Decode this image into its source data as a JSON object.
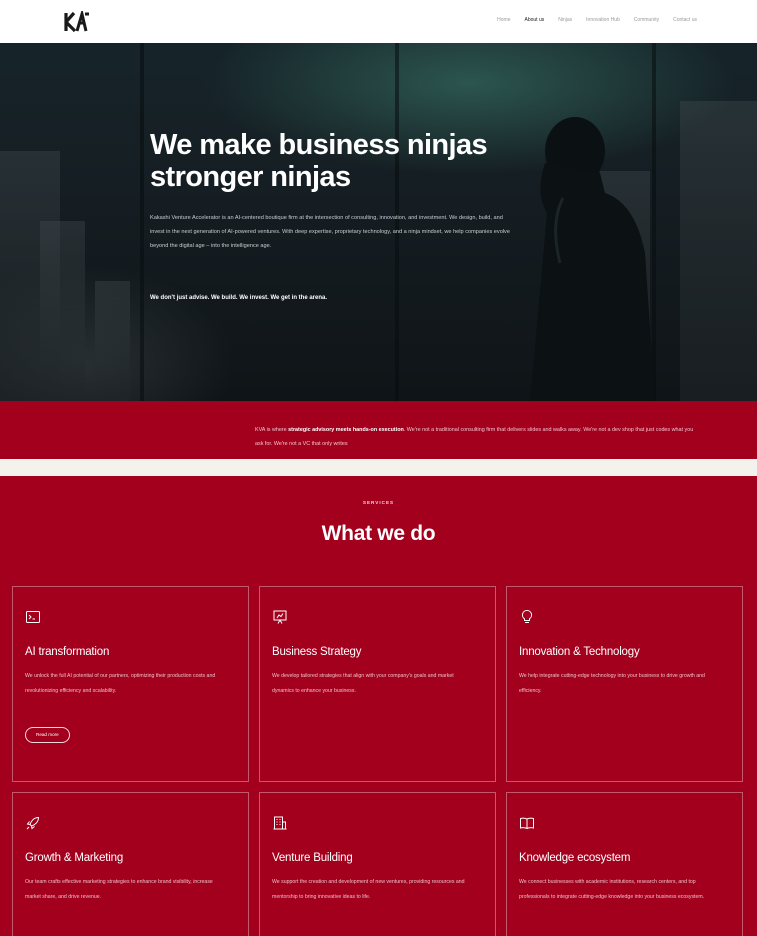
{
  "brand": {
    "logo_text": "KVA"
  },
  "nav": {
    "items": [
      {
        "label": "Home",
        "active": false
      },
      {
        "label": "About us",
        "active": true
      },
      {
        "label": "Ninjas",
        "active": false
      },
      {
        "label": "Innovation Hub",
        "active": false
      },
      {
        "label": "Community",
        "active": false
      },
      {
        "label": "Contact us",
        "active": false
      }
    ]
  },
  "hero": {
    "title_line1": "We make business ninjas",
    "title_line2": "stronger ninjas",
    "body": "Kakashi Venture Accelerator is an AI-centered boutique firm at the intersection of consulting, innovation, and investment. We design, build, and invest in the next generation of AI-powered ventures. With deep expertise, proprietary technology, and a ninja mindset, we help companies evolve beyond the digital age – into the intelligence age.",
    "tagline": "We don't just advise. We build. We invest. We get in the arena."
  },
  "intro": {
    "lead": "KVA is where ",
    "bold": "strategic advisory meets hands-on execution",
    "rest": ". We're not a traditional consulting firm that delivers slides and walks away. We're not a dev shop that just codes what you ask for. We're not a VC that only writes"
  },
  "services": {
    "eyebrow": "SERVICES",
    "title": "What we do",
    "read_more_label": "Read more",
    "cards": [
      {
        "icon": "terminal-icon",
        "title": "AI transformation",
        "desc": "We unlock the full AI potential of our partners, optimizing their production costs and revolutionizing efficiency and scalability."
      },
      {
        "icon": "presentation-chart-icon",
        "title": "Business Strategy",
        "desc": "We develop tailored strategies that align with your company's goals and market dynamics to enhance your business."
      },
      {
        "icon": "lightbulb-icon",
        "title": "Innovation & Technology",
        "desc": "We help integrate cutting-edge technology into your business to drive growth and efficiency."
      },
      {
        "icon": "rocket-icon",
        "title": "Growth & Marketing",
        "desc": "Our team crafts effective marketing strategies to enhance brand visibility, increase market share, and drive revenue."
      },
      {
        "icon": "building-icon",
        "title": "Venture Building",
        "desc": "We support the creation and development of new ventures, providing resources and mentorship to bring innovative ideas to life."
      },
      {
        "icon": "book-icon",
        "title": "Knowledge ecosystem",
        "desc": "We connect businesses with academic institutions, research centers, and top professionals to integrate cutting-edge knowledge into your business ecosystem."
      }
    ]
  },
  "colors": {
    "brand_red": "#a3001e",
    "hero_dark": "#151d22",
    "page_bg": "#f4f2ec"
  }
}
